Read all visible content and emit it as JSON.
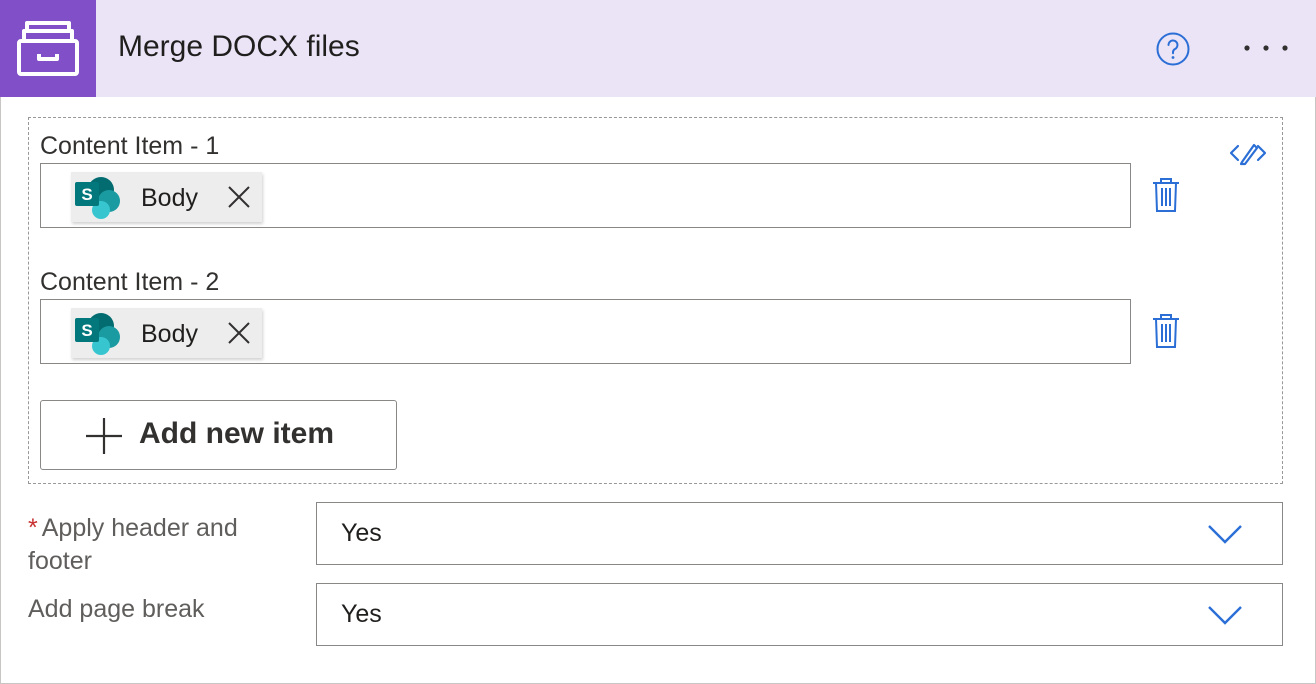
{
  "header": {
    "title": "Merge DOCX files",
    "icon": "archive-drawer-icon",
    "help_icon": "question-circle-icon",
    "more_icon": "ellipsis-icon",
    "accent_color": "#8150c9",
    "background_color": "#ebe4f7"
  },
  "content_items": [
    {
      "label": "Content Item - 1",
      "token": {
        "label": "Body",
        "icon": "sharepoint-icon"
      }
    },
    {
      "label": "Content Item - 2",
      "token": {
        "label": "Body",
        "icon": "sharepoint-icon"
      }
    }
  ],
  "add_button": {
    "label": "Add new item"
  },
  "fields": [
    {
      "label": "Apply header and footer",
      "required_marker": "*",
      "value": "Yes"
    },
    {
      "label": "Add page break",
      "value": "Yes"
    }
  ],
  "link_color": "#2b6fd6"
}
